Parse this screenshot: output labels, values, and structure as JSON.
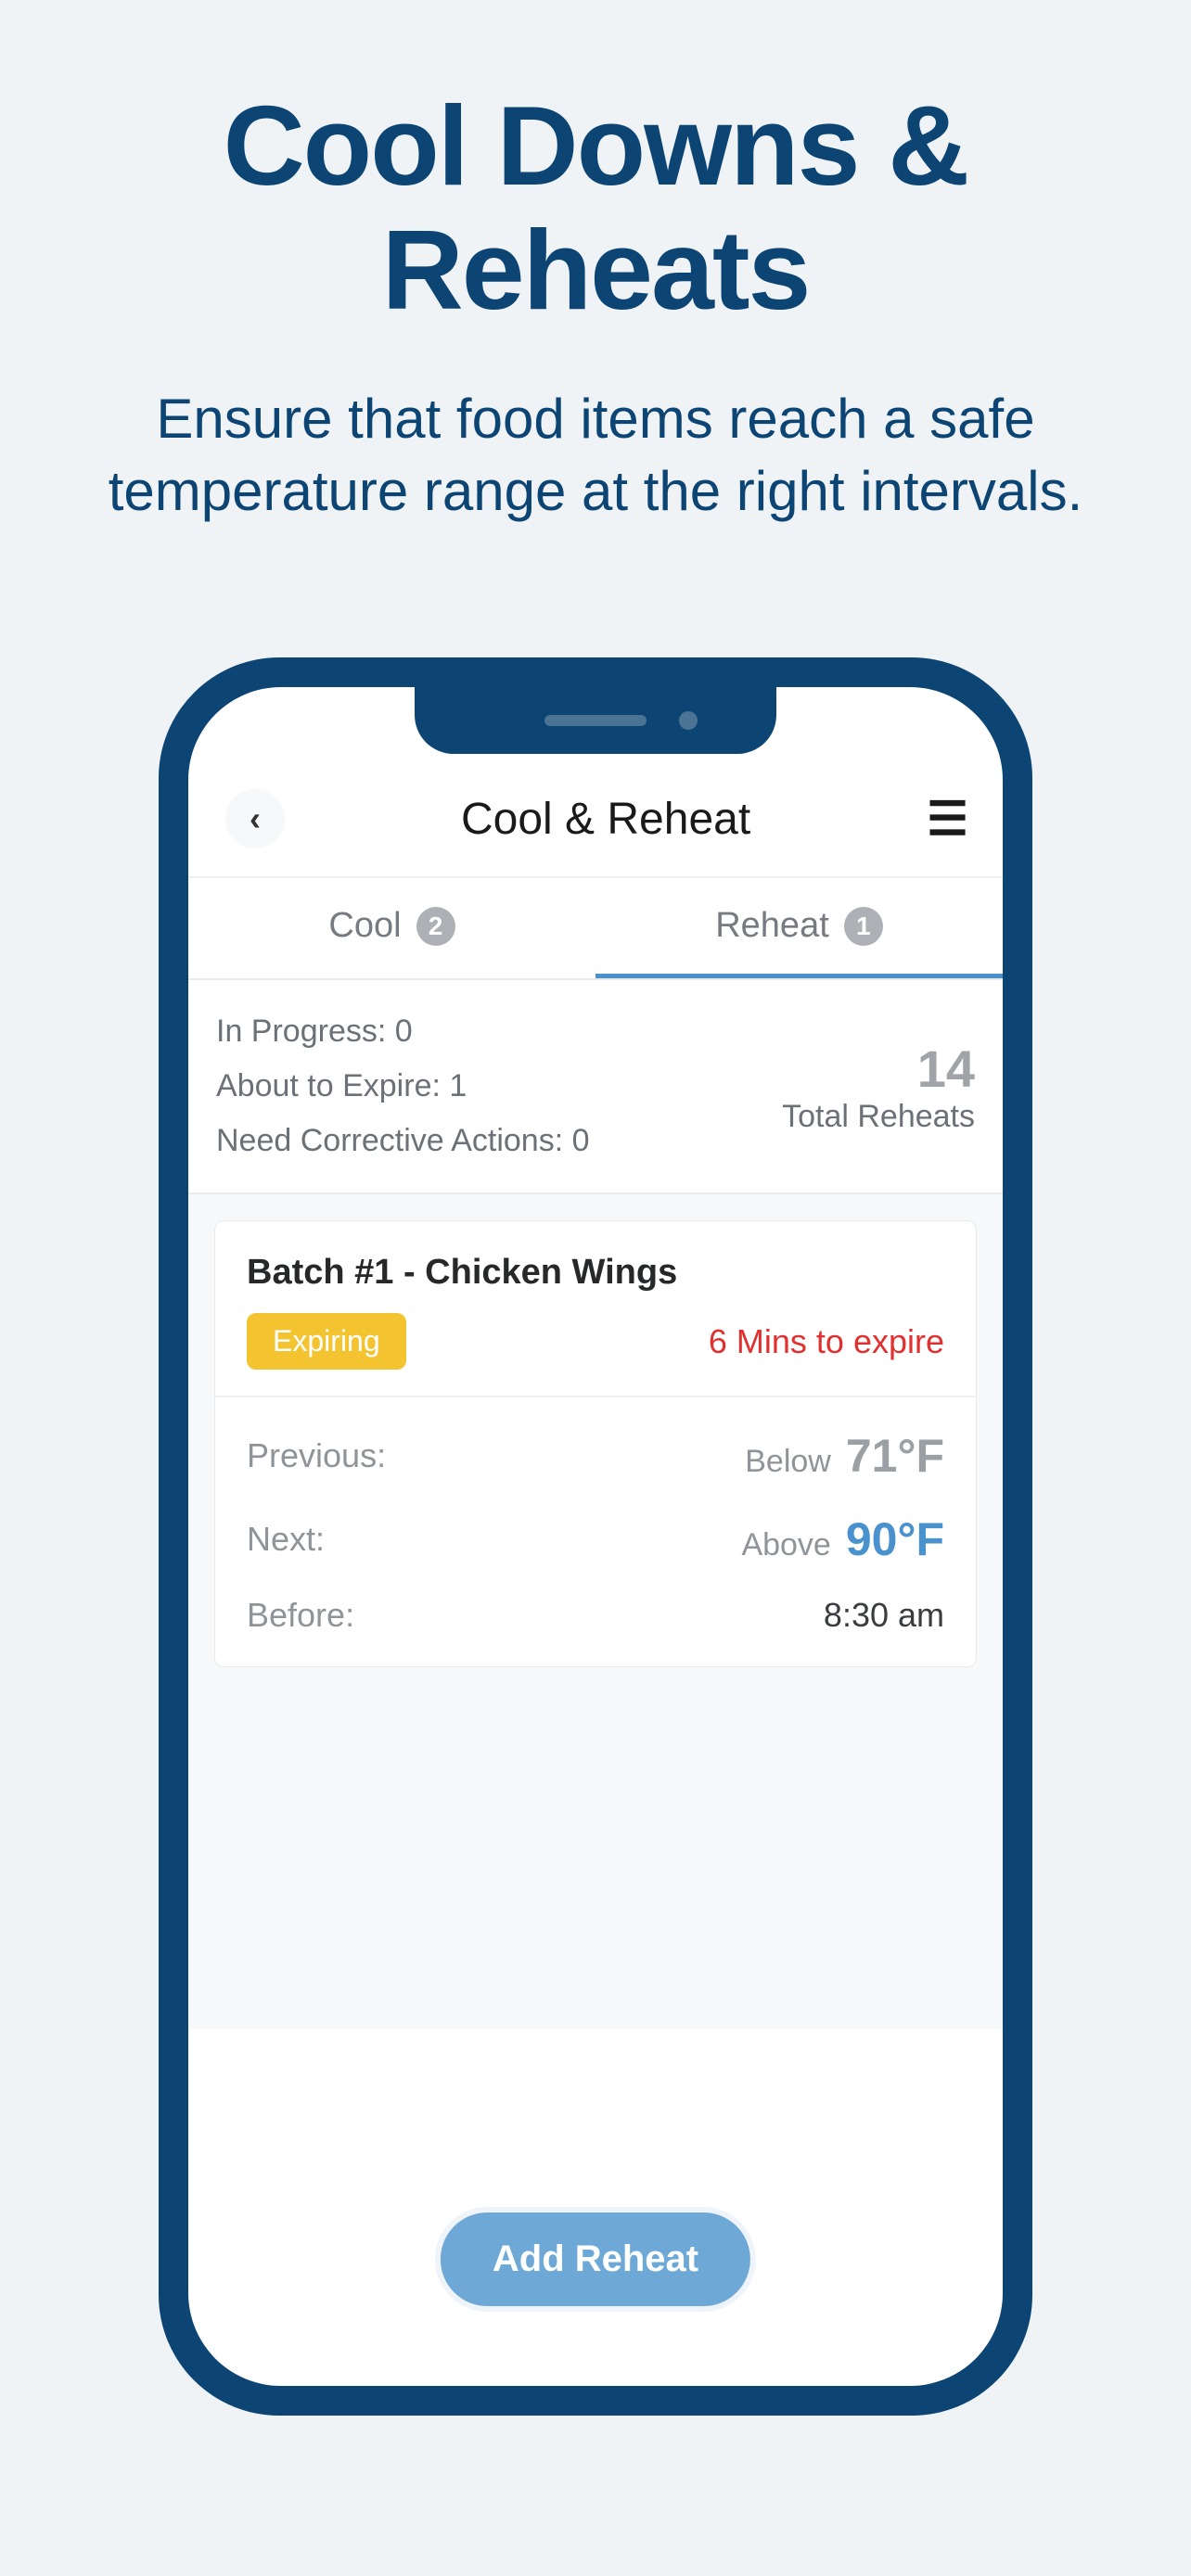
{
  "marketing": {
    "title": "Cool Downs & Reheats",
    "subtitle": "Ensure that food items reach a safe temperature range at the right intervals."
  },
  "header": {
    "back_icon": "‹",
    "title": "Cool & Reheat",
    "menu_icon": "☰"
  },
  "tabs": {
    "cool": {
      "label": "Cool",
      "count": "2"
    },
    "reheat": {
      "label": "Reheat",
      "count": "1"
    }
  },
  "stats": {
    "in_progress": "In Progress: 0",
    "about_to_expire": "About to Expire: 1",
    "need_corrective": "Need Corrective Actions: 0",
    "total_number": "14",
    "total_label": "Total Reheats"
  },
  "batch": {
    "title": "Batch #1 - Chicken Wings",
    "badge": "Expiring",
    "expire_text": "6 Mins to expire",
    "previous_label": "Previous:",
    "previous_qualifier": "Below",
    "previous_temp": "71°F",
    "next_label": "Next:",
    "next_qualifier": "Above",
    "next_temp": "90°F",
    "before_label": "Before:",
    "before_time": "8:30 am"
  },
  "action": {
    "add_reheat": "Add Reheat"
  }
}
